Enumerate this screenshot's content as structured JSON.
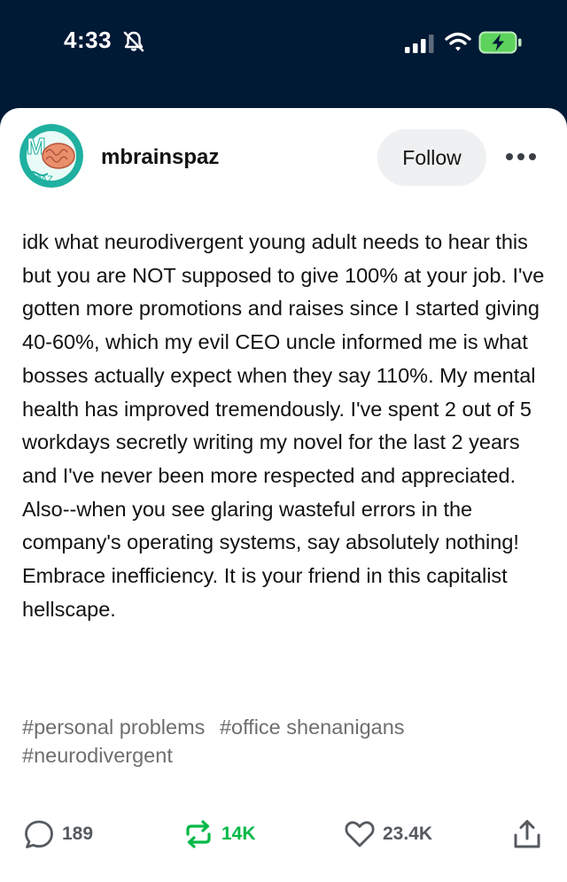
{
  "status_bar": {
    "time": "4:33",
    "icons": [
      "bell-slash-icon",
      "cellular-signal-icon",
      "wifi-icon",
      "battery-charging-icon"
    ]
  },
  "post": {
    "author": {
      "username": "mbrainspaz",
      "avatar_icon": "brain-avatar-icon"
    },
    "follow_label": "Follow",
    "more_icon": "ellipsis-icon",
    "body": "idk what neurodivergent young adult needs to hear this but you are NOT supposed to give 100% at your job. I've gotten more promotions and raises since I started giving 40-60%, which my evil CEO uncle informed me is what bosses actually expect when they say 110%. My mental health has improved tremendously. I've spent 2 out of 5 workdays secretly writing my novel for the last 2 years and I've never been more respected and appreciated. Also--when you see glaring wasteful errors in the company's operating systems, say absolutely nothing! Embrace inefficiency. It is your friend in this capitalist hellscape.",
    "tags": [
      "#personal problems",
      "#office shenanigans",
      "#neurodivergent"
    ]
  },
  "actions": {
    "comments": "189",
    "reblogs": "14K",
    "likes": "23.4K"
  },
  "colors": {
    "status_bg": "#001935",
    "reblog_green": "#00b846",
    "battery_green": "#5dd35d",
    "avatar_teal": "#1fb0a0"
  }
}
